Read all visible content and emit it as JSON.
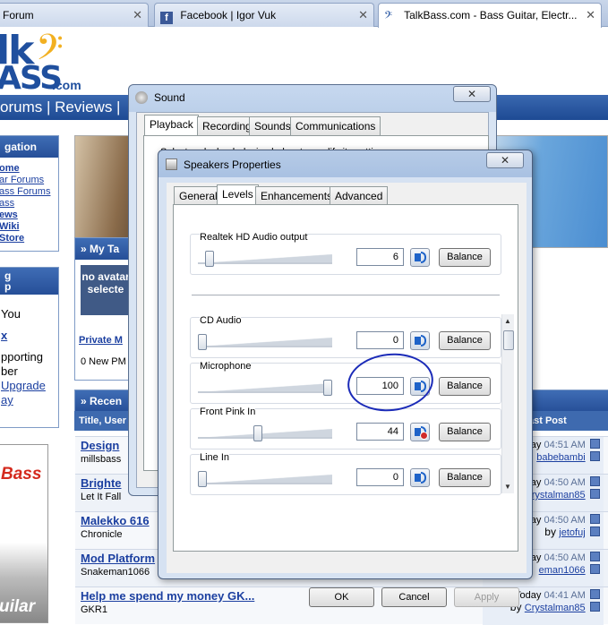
{
  "browser": {
    "tabs": [
      {
        "title": "Forum",
        "active": false
      },
      {
        "title": "Facebook | Igor Vuk",
        "active": false
      },
      {
        "title": "TalkBass.com - Bass Guitar, Electr...",
        "active": true
      }
    ]
  },
  "site": {
    "logo_top": "lk",
    "logo_bottom": "ASS",
    "logo_com": ".com",
    "nav_text": "orums | Reviews |",
    "navigation": {
      "header": "gation",
      "links": [
        "ome",
        "ar Forums",
        "ass Forums",
        "ass",
        "ews",
        "Wiki",
        "Store"
      ]
    },
    "mytalk_header": "» My Ta",
    "avatar_text": "no avatar selecte",
    "left_box": {
      "header_1": "g",
      "header_2": "p",
      "you": "You",
      "x": "x",
      "pporting": "pporting",
      "ber": "ber",
      "upgrade": "Upgrade",
      "ay": "ay"
    },
    "private_messages": "Private M",
    "new_pm": "0 New PM",
    "recent_header": "» Recen",
    "col_title": "Title, User",
    "col_last_post": "ast Post",
    "ad_text": "Bass",
    "ad_bottom": "uilar",
    "threads": [
      {
        "title": "Design",
        "sub": "millsbass",
        "time_day": "Today",
        "time": "04:51 AM",
        "by": "babebambi"
      },
      {
        "title": "Brighte",
        "sub": "Let It Fall",
        "time_day": "Today",
        "time": "04:50 AM",
        "by": "rystalman85"
      },
      {
        "title": "Malekko 616",
        "sub": "Chronicle",
        "time_day": "Today",
        "time": "04:50 AM",
        "by": "jetofuj",
        "by_prefix": "by"
      },
      {
        "title": "Mod Platform",
        "sub": "Snakeman1066",
        "time_day": "Today",
        "time": "04:50 AM",
        "by": "eman1066"
      },
      {
        "title": "Help me spend my money GK...",
        "sub": "GKR1",
        "time_day": "Today",
        "time": "04:41 AM",
        "by": "Crystalman85",
        "by_prefix": "by"
      }
    ]
  },
  "sound_dialog": {
    "title": "Sound",
    "close": "✕",
    "tabs": [
      "Playback",
      "Recording",
      "Sounds",
      "Communications"
    ],
    "hint": "Select a playback device below to modify its settings:"
  },
  "speakers_dialog": {
    "title": "Speakers Properties",
    "close": "✕",
    "tabs": [
      "General",
      "Levels",
      "Enhancements",
      "Advanced"
    ],
    "active_tab": "Levels",
    "balance_label": "Balance",
    "channels": [
      {
        "name": "Realtek HD Audio output",
        "value": "6",
        "level": 0.06,
        "muted": false
      },
      {
        "name": "CD Audio",
        "value": "0",
        "level": 0.0,
        "muted": false
      },
      {
        "name": "Microphone",
        "value": "100",
        "level": 1.0,
        "muted": false
      },
      {
        "name": "Front Pink In",
        "value": "44",
        "level": 0.44,
        "muted": true
      },
      {
        "name": "Line In",
        "value": "0",
        "level": 0.0,
        "muted": false
      }
    ],
    "buttons": {
      "ok": "OK",
      "cancel": "Cancel",
      "apply": "Apply"
    }
  },
  "colors": {
    "accent": "#1f4f9e",
    "annotation_circle": "#1b2bb8",
    "mute_red": "#d12b2b"
  }
}
